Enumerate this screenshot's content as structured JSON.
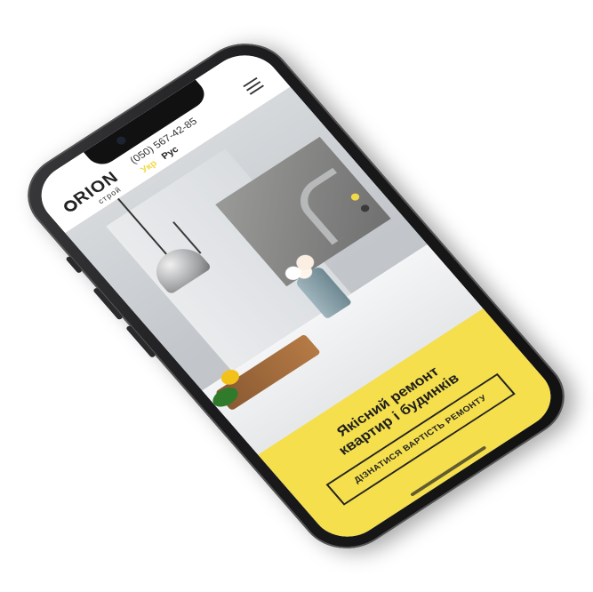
{
  "header": {
    "logo_text": "RION",
    "logo_sub": "строй",
    "phone": "(050) 567-42-85",
    "lang_active": "Укр",
    "lang_other": "Рус"
  },
  "banner": {
    "title_line1": "Якісний ремонт",
    "title_line2": "квартир і будинків",
    "cta_label": "ДІЗНАТИСЯ ВАРТІСТЬ РЕМОНТУ"
  },
  "colors": {
    "accent": "#f5df4d",
    "text": "#1f1f1f"
  },
  "icons": {
    "menu": "hamburger-menu-icon"
  }
}
